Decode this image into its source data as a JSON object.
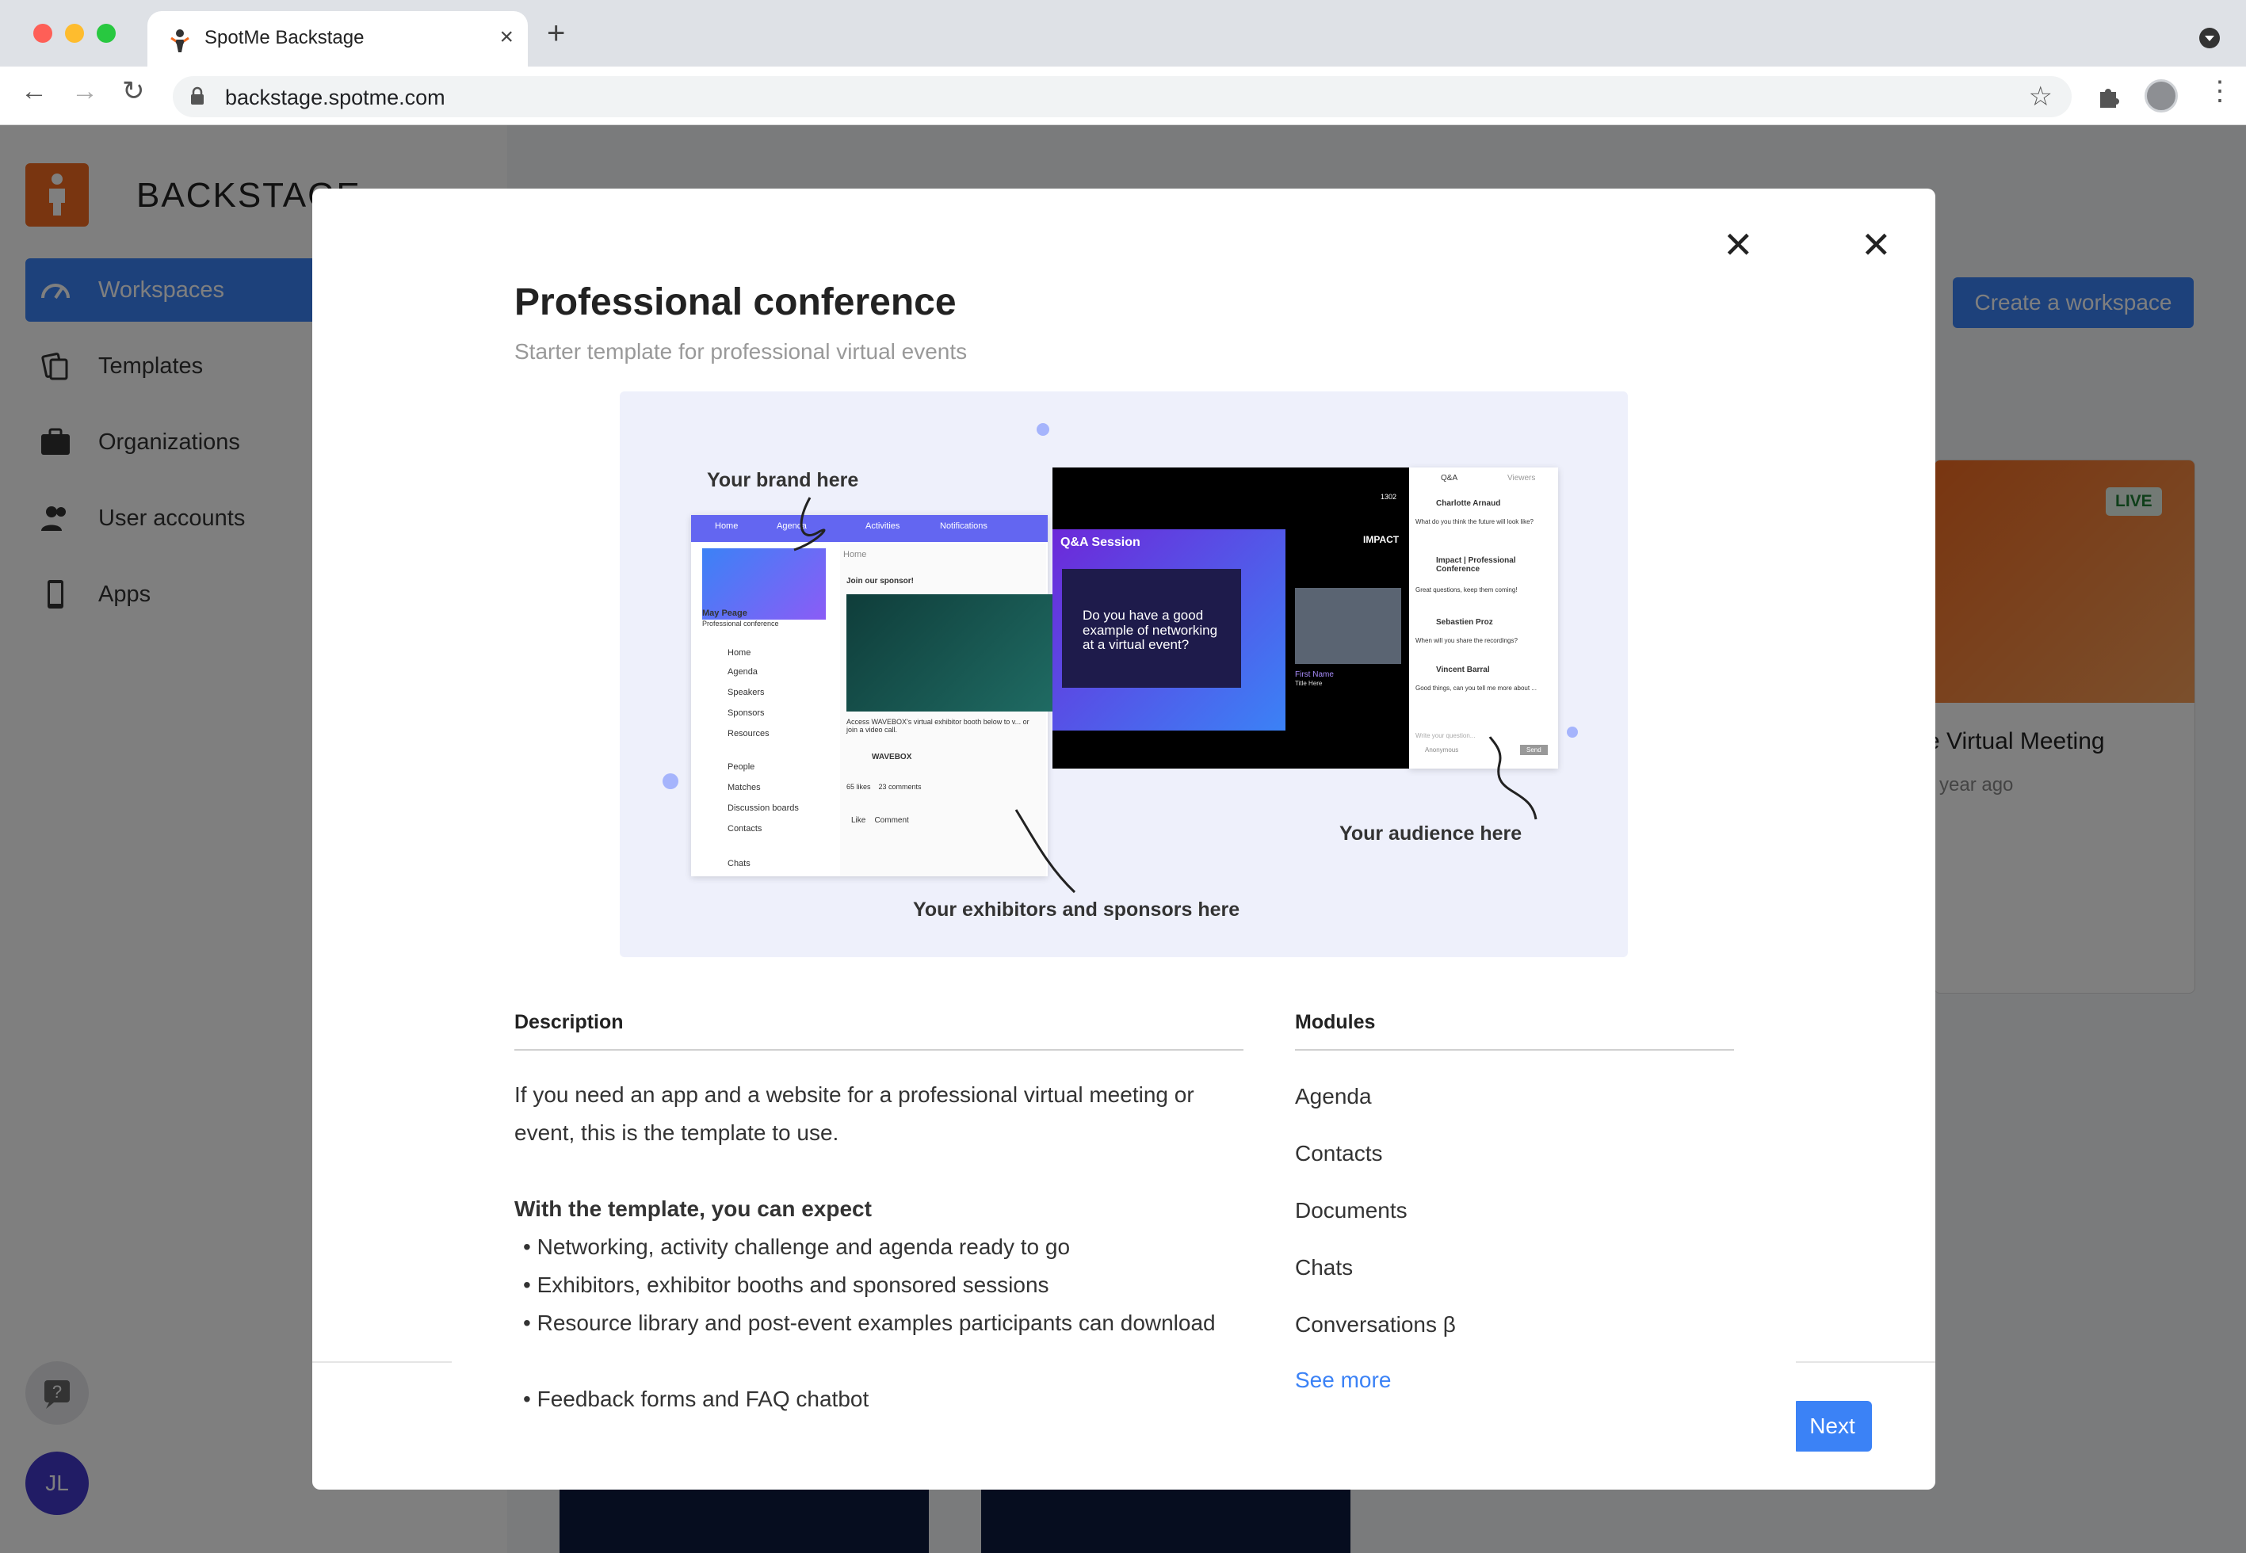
{
  "browser": {
    "tab_title": "SpotMe Backstage",
    "url": "backstage.spotme.com"
  },
  "sidebar": {
    "brand": "BACKSTAGE",
    "items": [
      {
        "label": "Workspaces",
        "icon": "gauge-icon"
      },
      {
        "label": "Templates",
        "icon": "templates-icon"
      },
      {
        "label": "Organizations",
        "icon": "briefcase-icon"
      },
      {
        "label": "User accounts",
        "icon": "users-icon"
      },
      {
        "label": "Apps",
        "icon": "phone-icon"
      }
    ],
    "user_initials": "JL"
  },
  "main": {
    "create_button": "Create a workspace",
    "card": {
      "badge": "LIVE",
      "title": "e Virtual Meeting",
      "subtitle": "year ago"
    }
  },
  "back_modal": {
    "next_button": "Next"
  },
  "modal": {
    "title": "Professional conference",
    "subtitle": "Starter template for professional virtual events",
    "preview": {
      "brand_note": "Your brand here",
      "exhibitors_note": "Your exhibitors and sponsors here",
      "audience_note": "Your audience here",
      "nav": [
        "Home",
        "Agenda",
        "Activities",
        "Notifications"
      ],
      "profile_name": "May Peage",
      "profile_sub": "Professional conference",
      "menu": [
        "Home",
        "Agenda",
        "Speakers",
        "Sponsors",
        "Resources",
        "People",
        "Matches",
        "Discussion boards",
        "Contacts",
        "Chats"
      ],
      "feed_header": "Home",
      "sponsor_label": "Join our sponsor!",
      "sponsor_text": "Access WAVEBOX's virtual exhibitor booth below to v... or join a video call.",
      "sponsor_name": "WAVEBOX",
      "stats": "65 likes    23 comments",
      "actions": "Like    Comment",
      "session_title": "Q&A Session",
      "question": "Do you have a good example of networking at a virtual event?",
      "speaker_name": "First Name",
      "speaker_title": "Title Here",
      "stage_brand": "IMPACT",
      "viewers_count": "1302",
      "chat_tabs": [
        "Q&A",
        "Viewers"
      ],
      "chat_messages": [
        {
          "name": "Charlotte Arnaud",
          "text": "What do you think the future will look like?"
        },
        {
          "name": "Impact | Professional Conference",
          "text": "Great questions, keep them coming!"
        },
        {
          "name": "Sebastien Proz",
          "text": "When will you share the recordings?"
        },
        {
          "name": "Vincent Barral",
          "text": "Good things, can you tell me more about ..."
        }
      ],
      "chat_input": "Write your question...",
      "chat_anon": "Anonymous",
      "chat_send": "Send"
    },
    "description": {
      "heading": "Description",
      "intro": "If you need an app and a website for a professional virtual meeting or event, this is the template to use.",
      "expect_heading": "With the template, you can expect",
      "bullets": [
        "Networking, activity challenge and agenda ready to go",
        "Exhibitors, exhibitor booths and sponsored sessions",
        "Resource library and post-event examples participants can download",
        "Feedback forms and FAQ chatbot"
      ]
    },
    "modules": {
      "heading": "Modules",
      "items": [
        "Agenda",
        "Contacts",
        "Documents",
        "Chats",
        "Conversations β"
      ],
      "see_more": "See more"
    }
  }
}
